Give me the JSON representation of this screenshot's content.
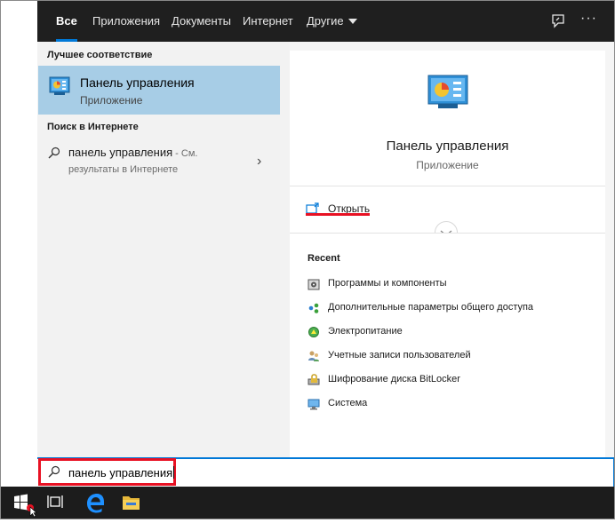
{
  "tabs": [
    {
      "label": "Все",
      "active": true
    },
    {
      "label": "Приложения"
    },
    {
      "label": "Документы"
    },
    {
      "label": "Интернет"
    },
    {
      "label": "Другие"
    }
  ],
  "top_icons": [
    "feedback-icon",
    "more-icon"
  ],
  "more_glyph": "···",
  "best_match": {
    "heading": "Лучшее соответствие",
    "title": "Панель управления",
    "subtitle": "Приложение",
    "icon": "control-panel-icon"
  },
  "web_search": {
    "heading": "Поиск в Интернете",
    "query": "панель управления",
    "suffix": " - См.",
    "line2": "результаты в Интернете",
    "chevron": "›"
  },
  "details": {
    "title": "Панель управления",
    "subtitle": "Приложение",
    "open_label": "Открыть"
  },
  "recent": {
    "heading": "Recent",
    "items": [
      {
        "label": "Программы и компоненты",
        "icon": "programs-icon"
      },
      {
        "label": "Дополнительные параметры общего доступа",
        "icon": "network-sharing-icon"
      },
      {
        "label": "Электропитание",
        "icon": "power-icon"
      },
      {
        "label": "Учетные записи пользователей",
        "icon": "user-accounts-icon"
      },
      {
        "label": "Шифрование диска BitLocker",
        "icon": "bitlocker-icon"
      },
      {
        "label": "Система",
        "icon": "system-icon"
      }
    ]
  },
  "search": {
    "value": "панель управления"
  },
  "taskbar": [
    "windows-start-icon",
    "task-view-icon",
    "edge-icon",
    "file-explorer-icon"
  ],
  "colors": {
    "accent": "#0078d7",
    "highlight": "#e81123",
    "selected": "#a7cde6",
    "topbar": "#1f1f1f"
  }
}
